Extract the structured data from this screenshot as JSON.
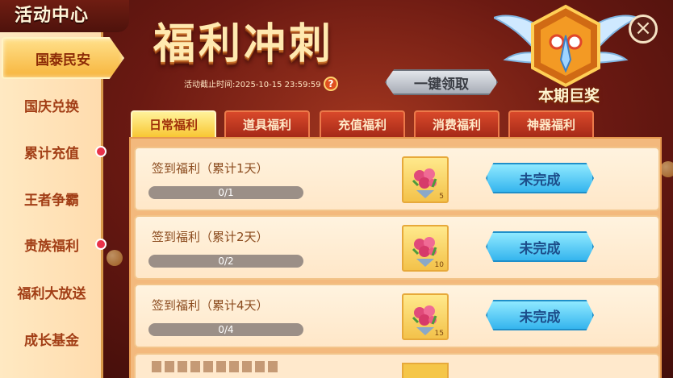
{
  "sidebar": {
    "title": "活动中心",
    "items": [
      {
        "label": "国泰民安",
        "active": true,
        "dot": false
      },
      {
        "label": "国庆兑换",
        "active": false,
        "dot": false
      },
      {
        "label": "累计充值",
        "active": false,
        "dot": true
      },
      {
        "label": "王者争霸",
        "active": false,
        "dot": false
      },
      {
        "label": "贵族福利",
        "active": false,
        "dot": true
      },
      {
        "label": "福利大放送",
        "active": false,
        "dot": false
      },
      {
        "label": "成长基金",
        "active": false,
        "dot": false
      }
    ]
  },
  "header": {
    "title": "福利冲刺",
    "deadline": "活动截止时间:2025-10-15 23:59:59",
    "help_icon": "question-icon",
    "claim_all_label": "一键领取",
    "grand_prize_label": "本期巨奖",
    "close_icon": "close-icon"
  },
  "tabs": [
    {
      "label": "日常福利",
      "active": true
    },
    {
      "label": "道具福利",
      "active": false
    },
    {
      "label": "充值福利",
      "active": false
    },
    {
      "label": "消费福利",
      "active": false
    },
    {
      "label": "神器福利",
      "active": false
    }
  ],
  "tasks": [
    {
      "title": "签到福利（累计1天）",
      "progress_text": "0/1",
      "progress": 0,
      "reward_icon": "rose-bouquet-icon",
      "reward_count": "5",
      "status_label": "未完成"
    },
    {
      "title": "签到福利（累计2天）",
      "progress_text": "0/2",
      "progress": 0,
      "reward_icon": "rose-bouquet-icon",
      "reward_count": "10",
      "status_label": "未完成"
    },
    {
      "title": "签到福利（累计4天）",
      "progress_text": "0/4",
      "progress": 0,
      "reward_icon": "rose-bouquet-icon",
      "reward_count": "15",
      "status_label": "未完成"
    }
  ],
  "colors": {
    "sidebar_bg": "#ffdcae",
    "active_tab": "#f8c733",
    "tab_bg": "#c2381f",
    "status_button": "#35b5ee",
    "bg_dark": "#6a1912"
  }
}
